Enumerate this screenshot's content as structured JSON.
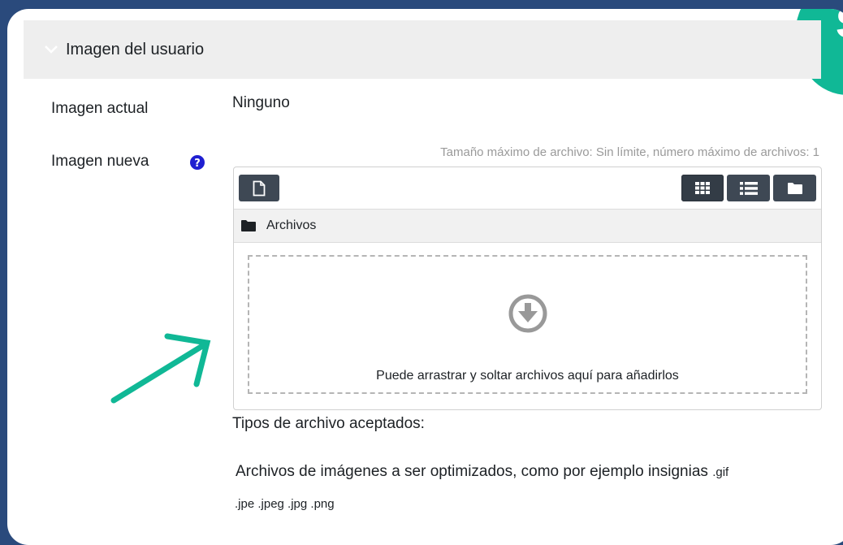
{
  "section": {
    "title": "Imagen del usuario"
  },
  "badge": {
    "letter": "S"
  },
  "current_image": {
    "label": "Imagen actual",
    "value": "Ninguno"
  },
  "new_image": {
    "label": "Imagen nueva",
    "max_info": "Tamaño máximo de archivo: Sin límite, número máximo de archivos: 1"
  },
  "filepicker": {
    "path_label": "Archivos",
    "drop_text": "Puede arrastrar y soltar archivos aquí para añadirlos"
  },
  "accepted": {
    "heading": "Tipos de archivo aceptados:",
    "description": "Archivos de imágenes a ser optimizados, como por ejemplo insignias",
    "ext_gif": ".gif",
    "ext_rest": ".jpe .jpeg .jpg .png"
  },
  "colors": {
    "frame": "#2a4a7c",
    "accent": "#10b896",
    "button": "#3e4854",
    "help": "#1f1fd1"
  },
  "icons": [
    "chevron-down-icon",
    "help-icon",
    "new-file-icon",
    "grid-view-icon",
    "list-view-icon",
    "folder-view-icon",
    "folder-icon",
    "download-icon",
    "arrow-annotation"
  ]
}
